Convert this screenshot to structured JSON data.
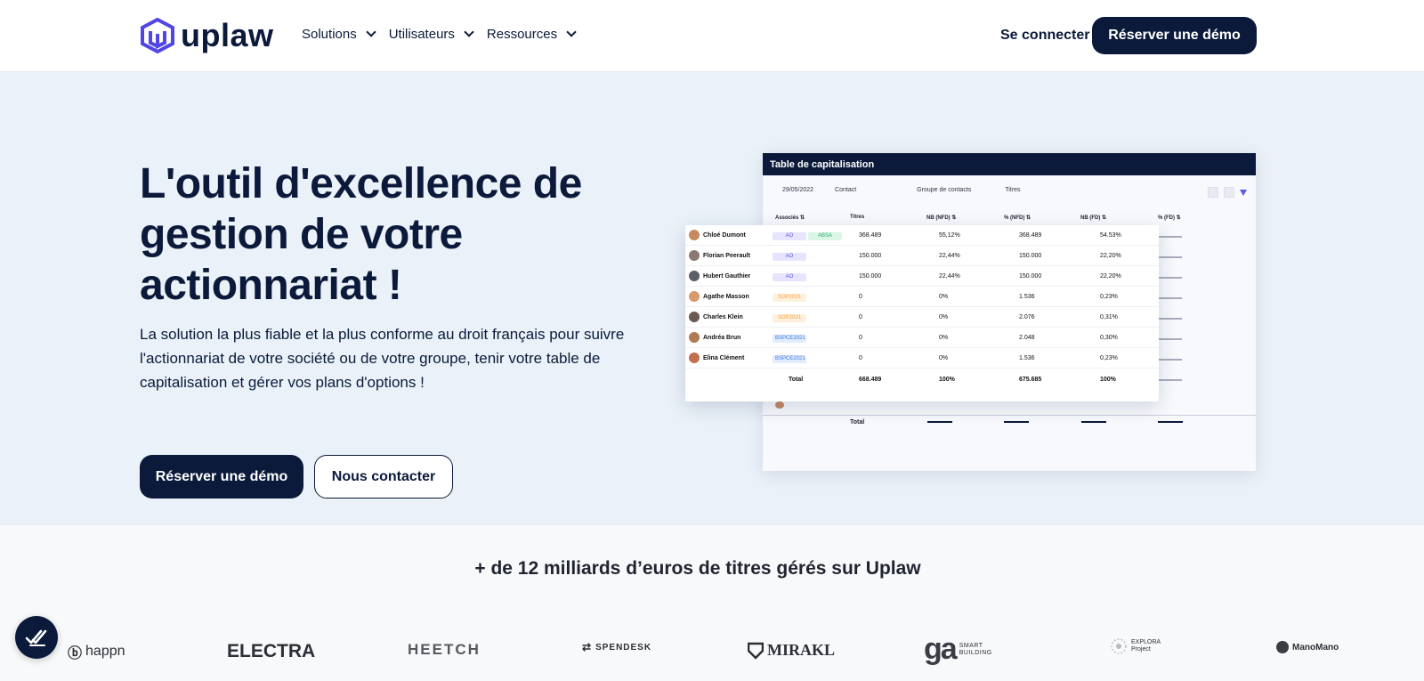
{
  "nav": {
    "logo_text": "uplaw",
    "menu": [
      "Solutions",
      "Utilisateurs",
      "Ressources"
    ],
    "login": "Se connecter",
    "demo_button": "Réserver une démo"
  },
  "hero": {
    "title": "L'outil d'excellence de gestion de votre actionnariat !",
    "subtitle": "La solution la plus fiable et la plus conforme au droit français pour suivre l'actionnariat de votre société ou de votre groupe, tenir votre table de capitalisation et gérer vos plans d'options !",
    "primary_button": "Réserver une démo",
    "secondary_button": "Nous contacter"
  },
  "cap_table": {
    "title": "Table de capitalisation",
    "filters": {
      "date": "29/05/2022",
      "contact": "Contact",
      "group": "Groupe de contacts",
      "titles": "Titres"
    },
    "columns": [
      "Associés ⇅",
      "Titres",
      "NB (NFD) ⇅",
      "% (NFD) ⇅",
      "NB (FD) ⇅",
      "% (FD) ⇅"
    ],
    "rows": [
      {
        "name": "Chloé Dumont",
        "badges": [
          "AO",
          "ABSA"
        ],
        "titres": "368.489",
        "pct_nfd": "55,12%",
        "nb_fd": "368.489",
        "pct_fd": "54.53%",
        "avatar": "#c58a62"
      },
      {
        "name": "Florian Peerault",
        "badges": [
          "AO"
        ],
        "titres": "150.000",
        "pct_nfd": "22,44%",
        "nb_fd": "150.000",
        "pct_fd": "22,20%",
        "avatar": "#8a7a72"
      },
      {
        "name": "Hubert Gauthier",
        "badges": [
          "AO"
        ],
        "titres": "150.000",
        "pct_nfd": "22,44%",
        "nb_fd": "150.000",
        "pct_fd": "22,20%",
        "avatar": "#5a5f68"
      },
      {
        "name": "Agathe Masson",
        "badges": [
          "SOP2021"
        ],
        "titres": "0",
        "pct_nfd": "0%",
        "nb_fd": "1.536",
        "pct_fd": "0,23%",
        "avatar": "#d89a6a"
      },
      {
        "name": "Charles Klein",
        "badges": [
          "SOP2021"
        ],
        "titres": "0",
        "pct_nfd": "0%",
        "nb_fd": "2.076",
        "pct_fd": "0,31%",
        "avatar": "#6b5a52"
      },
      {
        "name": "Andréa Brun",
        "badges": [
          "BSPCE2021"
        ],
        "titres": "0",
        "pct_nfd": "0%",
        "nb_fd": "2.048",
        "pct_fd": "0,30%",
        "avatar": "#b07a52"
      },
      {
        "name": "Elina Clément",
        "badges": [
          "BSPCE2021"
        ],
        "titres": "0",
        "pct_nfd": "0%",
        "nb_fd": "1.536",
        "pct_fd": "0,23%",
        "avatar": "#c0704e"
      }
    ],
    "total": {
      "label": "Total",
      "titres": "668.489",
      "pct_nfd": "100%",
      "nb_fd": "675.685",
      "pct_fd": "100%"
    },
    "total_back_label": "Total"
  },
  "stats": {
    "title": "+ de 12 milliards d’euros de titres gérés sur Uplaw"
  },
  "clients": [
    {
      "name": "happn",
      "icon": "happn-logo-icon"
    },
    {
      "name": "ELECTRA"
    },
    {
      "name": "HEETCH"
    },
    {
      "name": "SPENDESK",
      "icon": "spendesk-logo-icon"
    },
    {
      "name": "MIRAKL",
      "icon": "mirakl-logo-icon"
    },
    {
      "name": "SMART BUILDING",
      "mark": "ga"
    },
    {
      "name": "EXPLORA",
      "sub": "Project"
    },
    {
      "name": "ManoMano"
    }
  ],
  "colors": {
    "navy": "#0b1a3a",
    "hero_bg": "#eaf1f8",
    "accent": "#5a57e3"
  }
}
